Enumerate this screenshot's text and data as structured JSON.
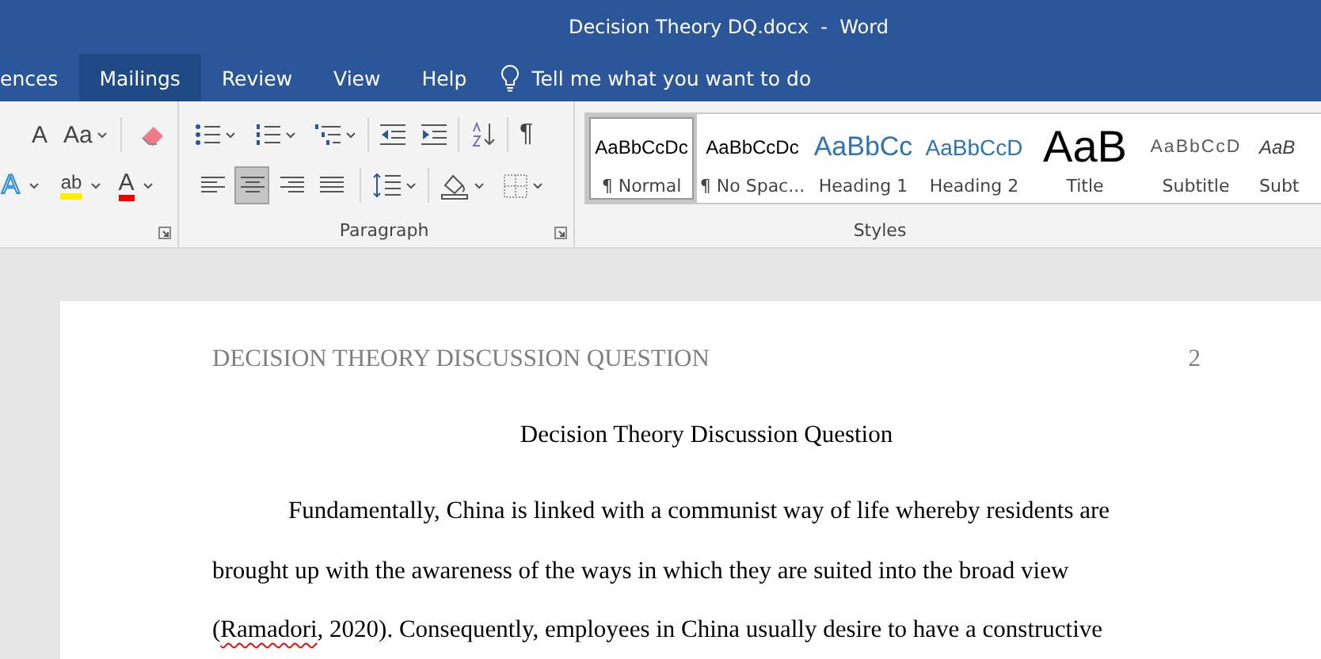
{
  "window": {
    "title": "Decision Theory DQ.docx  -  Word"
  },
  "tabs": [
    {
      "label": "ences",
      "selected": false
    },
    {
      "label": "Mailings",
      "selected": true
    },
    {
      "label": "Review",
      "selected": false
    },
    {
      "label": "View",
      "selected": false
    },
    {
      "label": "Help",
      "selected": false
    }
  ],
  "tell_me": {
    "placeholder": "Tell me what you want to do"
  },
  "font_group": {
    "row1": [
      {
        "kind": "shrink",
        "label": "A"
      },
      {
        "kind": "case",
        "label": "Aa"
      },
      {
        "kind": "clear"
      }
    ],
    "row2": [
      {
        "kind": "effects",
        "label": "A"
      },
      {
        "kind": "highlight",
        "label": "ab"
      },
      {
        "kind": "color",
        "label": "A"
      }
    ]
  },
  "paragraph_group": {
    "label": "Paragraph",
    "pilcrow": "¶",
    "alignments": [
      {
        "kind": "left",
        "selected": false
      },
      {
        "kind": "center",
        "selected": true
      },
      {
        "kind": "right",
        "selected": false
      },
      {
        "kind": "justify",
        "selected": false
      }
    ]
  },
  "styles_group": {
    "label": "Styles",
    "items": [
      {
        "kind": "normal",
        "preview": "AaBbCcDc",
        "label": "¶ Normal",
        "selected": true
      },
      {
        "kind": "normal",
        "preview": "AaBbCcDc",
        "label": "¶ No Spac...",
        "selected": false
      },
      {
        "kind": "heading1",
        "preview": "AaBbCc",
        "label": "Heading 1",
        "selected": false
      },
      {
        "kind": "heading2",
        "preview": "AaBbCcD",
        "label": "Heading 2",
        "selected": false
      },
      {
        "kind": "title",
        "preview": "AaB",
        "label": "Title",
        "selected": false
      },
      {
        "kind": "subtitle",
        "preview": "AaBbCcD",
        "label": "Subtitle",
        "selected": false
      },
      {
        "kind": "emphasis",
        "preview": "AaB",
        "label": "Subt",
        "selected": false
      }
    ]
  },
  "document": {
    "header": "DECISION THEORY DISCUSSION QUESTION",
    "page_number": "2",
    "title": "Decision Theory Discussion Question",
    "lines": [
      [
        {
          "text": "Fundamentally, China is linked with a communist way of life whereby residents are",
          "misspelled": false
        }
      ],
      [
        {
          "text": "brought up with the awareness of the ways in which they are suited into the broad view",
          "misspelled": false
        }
      ],
      [
        {
          "text": "(",
          "misspelled": false
        },
        {
          "text": "Ramadori",
          "misspelled": true
        },
        {
          "text": ", 2020). Consequently, employees in China usually desire to have a constructive",
          "misspelled": false
        }
      ]
    ]
  }
}
